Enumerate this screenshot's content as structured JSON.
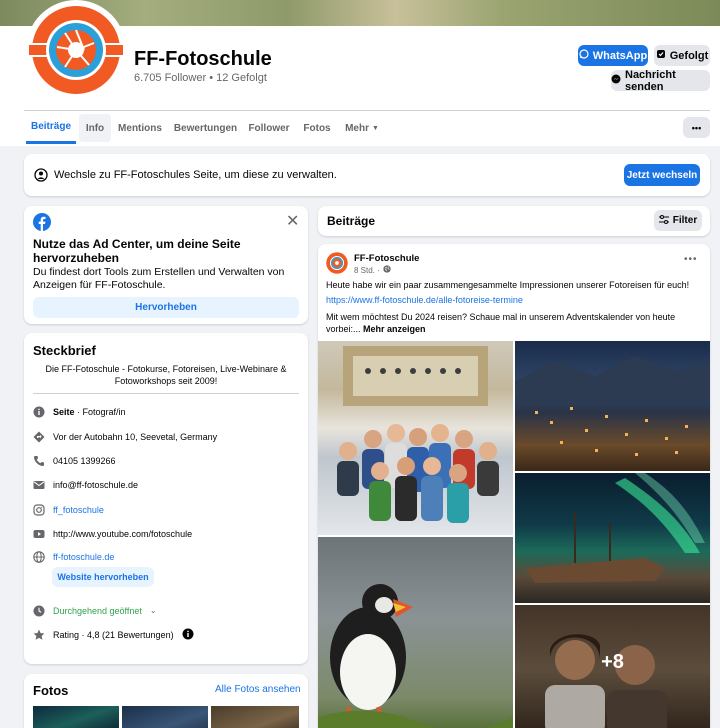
{
  "page": {
    "name": "FF-Fotoschule",
    "stats": "6.705 Follower • 12 Gefolgt"
  },
  "actions": {
    "whatsapp": "WhatsApp",
    "following": "Gefolgt",
    "message": "Nachricht senden"
  },
  "tabs": [
    "Beiträge",
    "Info",
    "Mentions",
    "Bewertungen",
    "Follower",
    "Fotos",
    "Mehr"
  ],
  "more_button": "•••",
  "switch_banner": {
    "text": "Wechsle zu FF-Fotoschules Seite, um diese zu verwalten.",
    "button": "Jetzt wechseln"
  },
  "ad_center": {
    "title": "Nutze das Ad Center, um deine Seite hervorzuheben",
    "text": "Du findest dort Tools zum Erstellen und Verwalten von Anzeigen für FF-Fotoschule.",
    "button": "Hervorheben"
  },
  "steckbrief": {
    "title": "Steckbrief",
    "intro": "Die FF-Fotoschule - Fotokurse, Fotoreisen, Live-Webinare & Fotoworkshops seit 2009!",
    "page_label": "Seite",
    "page_category": " · Fotograf/in",
    "address": "Vor der Autobahn 10, Seevetal, Germany",
    "phone": "04105 1399266",
    "email": "info@ff-fotoschule.de",
    "instagram": "ff_fotoschule",
    "youtube": "http://www.youtube.com/fotoschule",
    "website": "ff-fotoschule.de",
    "website_button": "Website hervorheben",
    "hours": "Durchgehend geöffnet",
    "rating": "Rating · 4,8 (21 Bewertungen)"
  },
  "photos_section": {
    "title": "Fotos",
    "link": "Alle Fotos ansehen"
  },
  "posts": {
    "title": "Beiträge",
    "filter": "Filter",
    "post": {
      "author": "FF-Fotoschule",
      "time": "8 Std. ·",
      "line1": "Heute habe wir ein paar zusammengesammelte Impressionen unserer Fotoreisen für euch!",
      "link": "https://www.ff-fotoschule.de/alle-fotoreise-termine",
      "line2": "Mit wem möchtest Du 2024 reisen? Schaue mal in unserem Adventskalender von heute vorbei:...",
      "more": "Mehr anzeigen",
      "more_photos": "+8"
    }
  },
  "colors": {
    "accent": "#1b74e4",
    "brand_orange": "#f15a22",
    "brand_blue": "#2a9fd8",
    "green": "#31a24c"
  }
}
